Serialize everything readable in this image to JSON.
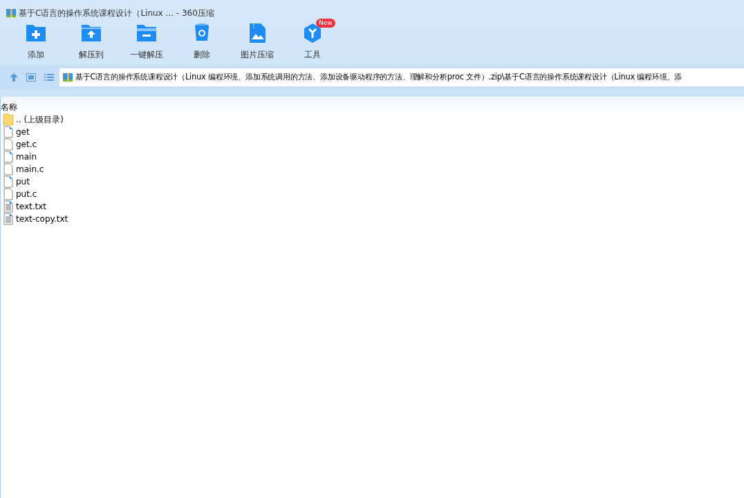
{
  "window": {
    "title": "基于C语言的操作系统课程设计（Linux ... - 360压缩"
  },
  "toolbar": [
    {
      "label": "添加",
      "kind": "add"
    },
    {
      "label": "解压到",
      "kind": "extract-to"
    },
    {
      "label": "一键解压",
      "kind": "extract"
    },
    {
      "label": "删除",
      "kind": "delete"
    },
    {
      "label": "图片压缩",
      "kind": "image"
    },
    {
      "label": "工具",
      "kind": "tools",
      "badge": "New"
    }
  ],
  "address_bar": {
    "path": "基于C语言的操作系统课程设计（Linux 编程环境、添加系统调用的方法、添加设备驱动程序的方法、理解和分析proc 文件）.zip\\基于C语言的操作系统课程设计（Linux 编程环境、添"
  },
  "file_list": {
    "columns": [
      "名称"
    ],
    "rows": [
      {
        "name": ".. (上级目录)",
        "kind": "folder"
      },
      {
        "name": "get",
        "kind": "program"
      },
      {
        "name": "get.c",
        "kind": "file"
      },
      {
        "name": "main",
        "kind": "program"
      },
      {
        "name": "main.c",
        "kind": "file"
      },
      {
        "name": "put",
        "kind": "program"
      },
      {
        "name": "put.c",
        "kind": "file"
      },
      {
        "name": "text.txt",
        "kind": "text"
      },
      {
        "name": "text-copy.txt",
        "kind": "text"
      }
    ]
  }
}
